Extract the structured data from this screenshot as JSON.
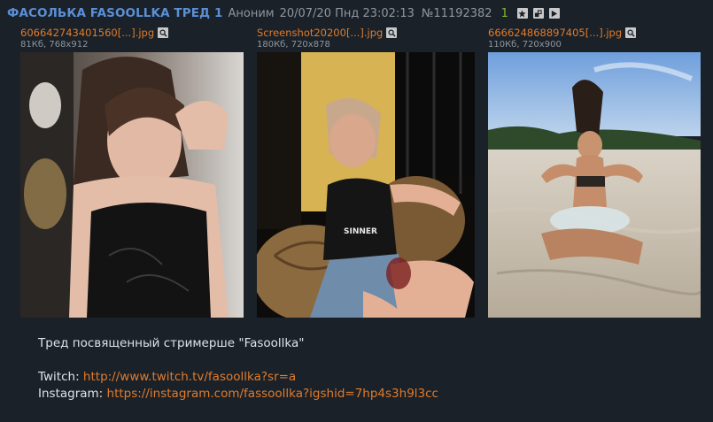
{
  "post": {
    "title": "ФАСОЛЬКА FASOOLLKA ТРЕД 1",
    "author": "Аноним",
    "datetime": "20/07/20 Пнд 23:02:13",
    "number": "№11192382",
    "replies": "1",
    "buttons": [
      "star-icon",
      "hide-icon",
      "play-icon"
    ]
  },
  "files": [
    {
      "name": "606642743401560[...].jpg",
      "info": "81Кб, 768x912"
    },
    {
      "name": "Screenshot20200[...].jpg",
      "info": "180Кб, 720x878"
    },
    {
      "name": "666624868897405[...].jpg",
      "info": "110Кб, 720x900"
    }
  ],
  "message": {
    "intro": "Тред посвященный стримерше \"Fasoollka\"",
    "twitch_label": "Twitch:",
    "twitch_url": "http://www.twitch.tv/fasoollka?sr=a",
    "instagram_label": "Instagram:",
    "instagram_url": "https://instagram.com/fassoollka?igshid=7hp4s3h9l3cc"
  },
  "colors": {
    "background": "#1a2129",
    "title": "#5b8fd6",
    "link": "#e07b2a",
    "reply_count": "#7fba3a"
  }
}
